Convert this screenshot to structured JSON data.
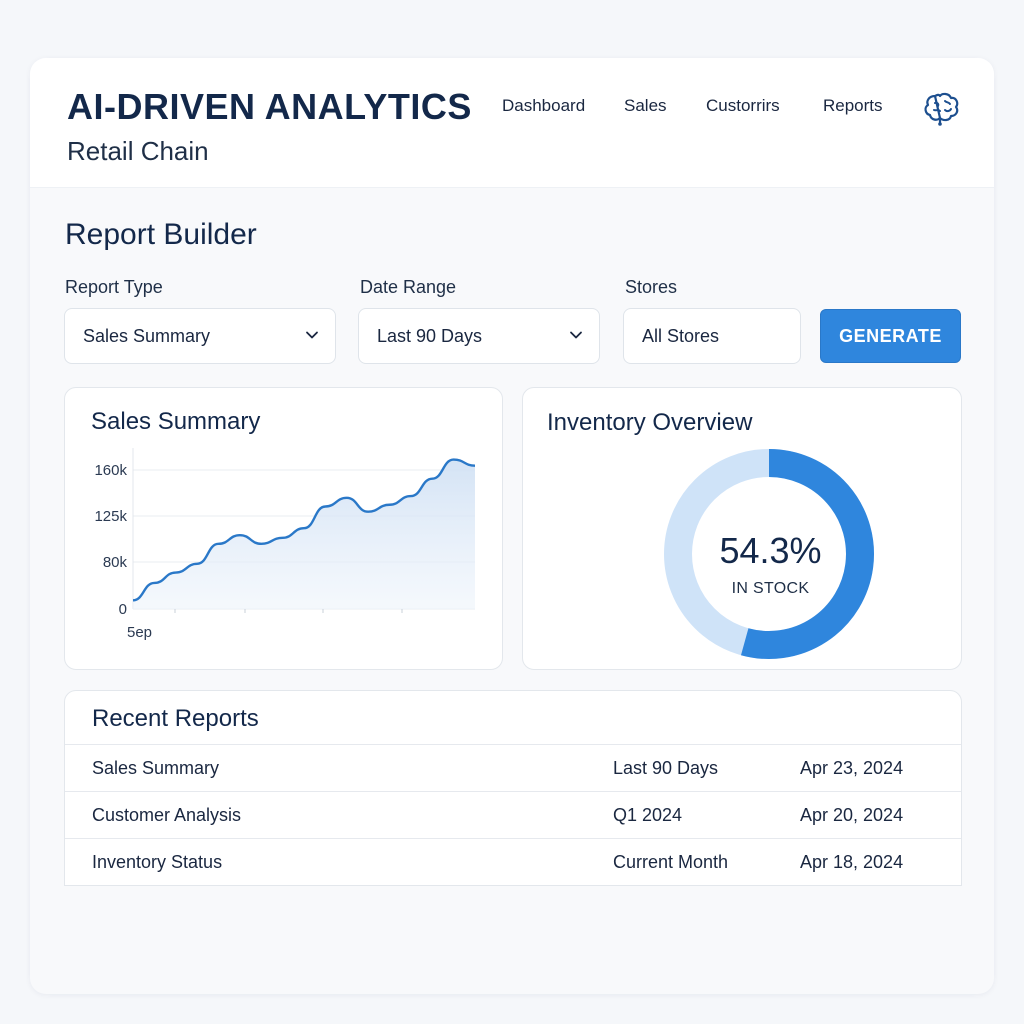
{
  "header": {
    "title": "AI-DRIVEN ANALYTICS",
    "subtitle": "Retail Chain",
    "nav": [
      "Dashboard",
      "Sales",
      "Custorrirs",
      "Reports"
    ],
    "icon": "brain-icon"
  },
  "builder": {
    "title": "Report Builder",
    "report_type": {
      "label": "Report Type",
      "value": "Sales Summary"
    },
    "date_range": {
      "label": "Date Range",
      "value": "Last 90 Days"
    },
    "stores": {
      "label": "Stores",
      "value": "All Stores"
    },
    "generate_label": "GENERATE"
  },
  "sales": {
    "title": "Sales Summary",
    "chart_data": {
      "type": "area",
      "y_ticks": [
        "160k",
        "125k",
        "80k",
        "0"
      ],
      "x_tick_labels": [
        "5ep"
      ],
      "ylim": [
        0,
        160
      ],
      "x": [
        0,
        1,
        2,
        3,
        4,
        5,
        6,
        7,
        8,
        9,
        10,
        11,
        12,
        13,
        14,
        15,
        16
      ],
      "values": [
        10,
        30,
        42,
        52,
        75,
        85,
        75,
        82,
        93,
        118,
        128,
        112,
        120,
        130,
        150,
        172,
        165
      ],
      "grid": true,
      "color": "#2a78c8"
    }
  },
  "inventory": {
    "title": "Inventory Overview",
    "value_text": "54.3%",
    "caption": "IN STOCK",
    "chart_data": {
      "type": "pie",
      "labels": [
        "In stock",
        "Other"
      ],
      "values": [
        54.3,
        45.7
      ],
      "colors": [
        "#2f86dd",
        "#cfe3f8"
      ]
    }
  },
  "recent": {
    "title": "Recent Reports",
    "rows": [
      {
        "name": "Sales Summary",
        "period": "Last 90 Days",
        "date": "Apr 23, 2024"
      },
      {
        "name": "Customer Analysis",
        "period": "Q1 2024",
        "date": "Apr 20, 2024"
      },
      {
        "name": "Inventory Status",
        "period": "Current Month",
        "date": "Apr 18, 2024"
      }
    ]
  }
}
